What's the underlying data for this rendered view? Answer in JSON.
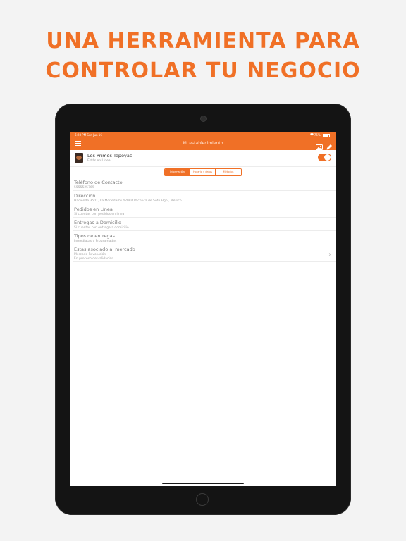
{
  "headline": {
    "line1": "UNA HERRAMIENTA PARA",
    "line2": "CONTROLAR TU NEGOCIO"
  },
  "colors": {
    "accent": "#f07026",
    "headline": "#f07026",
    "device": "#141414"
  },
  "statusbar": {
    "time": "6:28 PM",
    "date": "Sun Jun 16",
    "battery": "75%"
  },
  "navbar": {
    "title": "Mi establecimiento",
    "menu_icon": "hamburger-menu-icon",
    "action_icons": [
      "store-image-icon",
      "pencil-edit-icon"
    ]
  },
  "store": {
    "name": "Los Primos Tepeyac",
    "status": "Estás en Línea",
    "online": true
  },
  "segments": {
    "items": [
      {
        "label": "Información",
        "active": true
      },
      {
        "label": "Horario y datos",
        "active": false
      },
      {
        "label": "Métodos",
        "active": false
      }
    ]
  },
  "details": [
    {
      "label": "Teléfono de Contacto",
      "value": "5555525769"
    },
    {
      "label": "Dirección",
      "value": "Hacienda 3501, La Moneda(b) 42084 Pachuca de Soto Hgo., México"
    },
    {
      "label": "Pedidos en Línea",
      "value": "Sí cuentas con pedidos en línea"
    },
    {
      "label": "Entregas a Domicilio",
      "value": "Sí cuentas con entrega a domicilio"
    },
    {
      "label": "Tipos de entregas",
      "value": "Inmediatas y Programadas"
    },
    {
      "label": "Estas asociado al mercado",
      "value": "Mercado Revolución",
      "value2": "En proceso de validación",
      "has_chevron": true
    }
  ]
}
